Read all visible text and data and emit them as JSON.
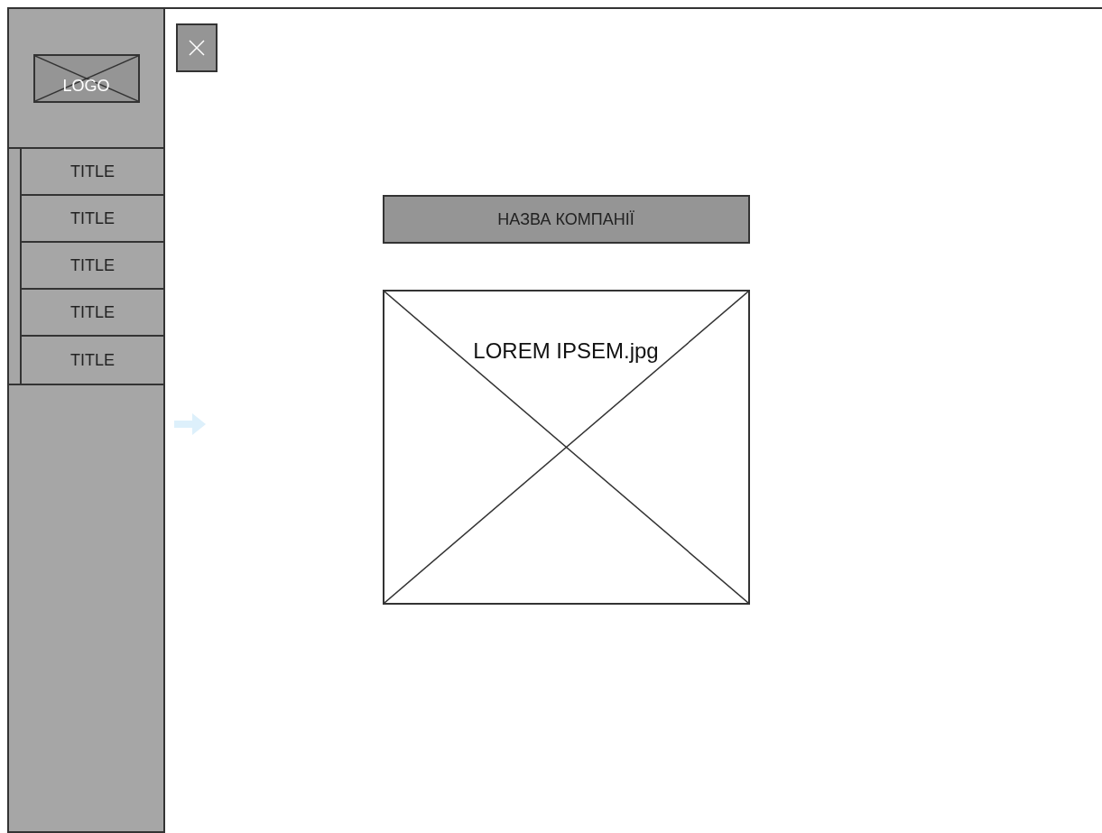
{
  "sidebar": {
    "logo": "LOGO",
    "items": [
      {
        "label": "TITLE"
      },
      {
        "label": "TITLE"
      },
      {
        "label": "TITLE"
      },
      {
        "label": "TITLE"
      },
      {
        "label": "TITLE"
      }
    ]
  },
  "main": {
    "company_name": "НАЗВА КОМПАНІЇ",
    "image": {
      "caption": "LOREM IPSEM.jpg"
    }
  }
}
